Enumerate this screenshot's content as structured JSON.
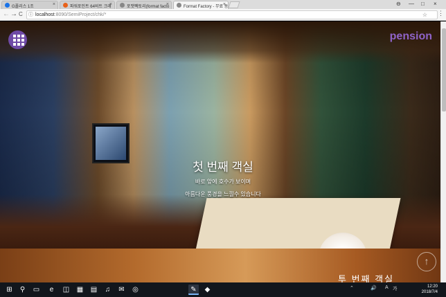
{
  "browser": {
    "tabs": [
      {
        "label": "G폴리스 1조",
        "icon_color": "#1a73e8",
        "active": false
      },
      {
        "label": "파워포인트 64비트 크래",
        "icon_color": "#e8611a",
        "active": false
      },
      {
        "label": "포맷팩토리(format facto",
        "icon_color": "#888888",
        "active": false
      },
      {
        "label": "Format Factory - 무료 동",
        "icon_color": "#888888",
        "active": true
      }
    ],
    "tab_close": "×",
    "url_host": "localhost",
    "url_path": ":8090/SemiProject/chk/*",
    "back": "←",
    "forward": "→",
    "reload": "C",
    "info_icon": "ⓘ",
    "star_icon": "☆",
    "menu_icon": "⋮",
    "window_controls": {
      "account": "⊖",
      "minimize": "—",
      "maximize": "□",
      "close": "×"
    }
  },
  "site": {
    "brand": "pension",
    "room_title": "첫 번째 객실",
    "line1": "바로 앞에 호수가 보이며",
    "line2": "아름다운 풍경을 느낄수 있습니다",
    "strip_caption": "투 번째 객실",
    "scroll_top_icon": "↑"
  },
  "taskbar": {
    "start_icon": "⊞",
    "search_icon": "⚲",
    "apps": [
      "▭",
      "e",
      "◫",
      "▦",
      "▤",
      "♫",
      "✉",
      "◎",
      "✎",
      "◆"
    ],
    "tray": [
      "⌃",
      "🔊",
      "A"
    ],
    "tray_lang": "가",
    "time": "12:20",
    "date": "2018/7/4"
  }
}
